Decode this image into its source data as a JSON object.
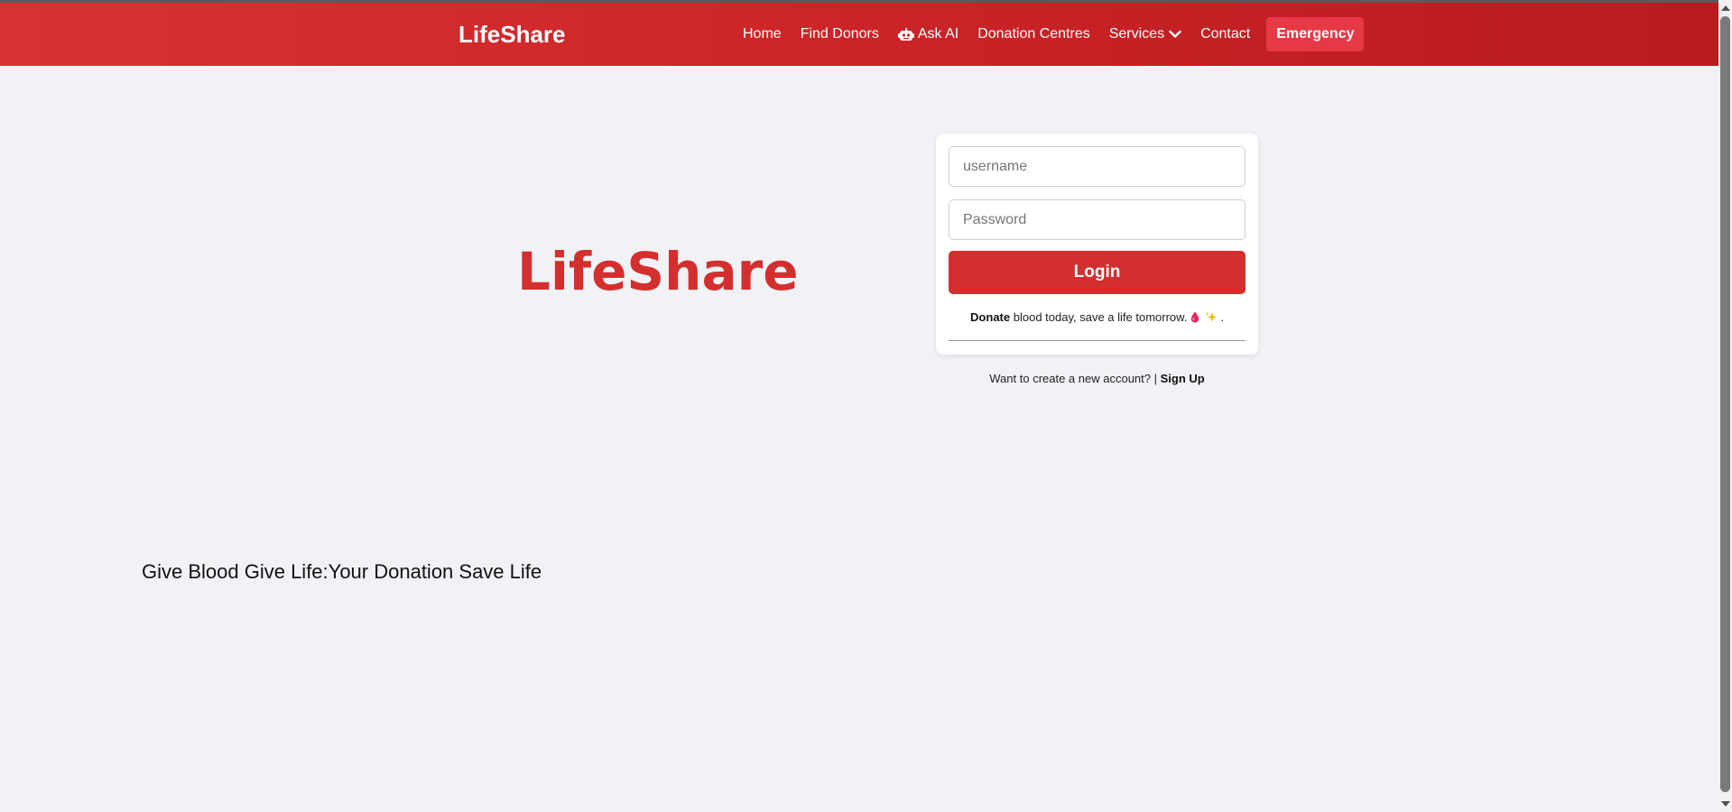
{
  "nav": {
    "brand": "LifeShare",
    "links": [
      {
        "label": "Home"
      },
      {
        "label": "Find Donors"
      },
      {
        "label": "Ask AI"
      },
      {
        "label": "Donation Centres"
      },
      {
        "label": "Services"
      },
      {
        "label": "Contact"
      }
    ],
    "emergency_label": "Emergency"
  },
  "hero": {
    "logo_text": "LifeShare",
    "slogan": "Give Blood Give Life:Your Donation Save Life"
  },
  "login": {
    "username_placeholder": "username",
    "password_placeholder": "Password",
    "button_label": "Login",
    "tagline_bold": "Donate",
    "tagline_rest": "blood today, save a life tomorrow.",
    "tagline_end": "."
  },
  "signup": {
    "prompt": "Want to create a new account? |",
    "link_label": "Sign Up"
  },
  "colors": {
    "brand_red": "#d32f2f",
    "emergency_red": "#e63946",
    "background": "#f0f2f5"
  },
  "icons": {
    "ask_ai": "robot-icon",
    "services": "chevron-down-icon",
    "tagline_1": "blood-drop-icon",
    "tagline_2": "sparkles-icon"
  }
}
